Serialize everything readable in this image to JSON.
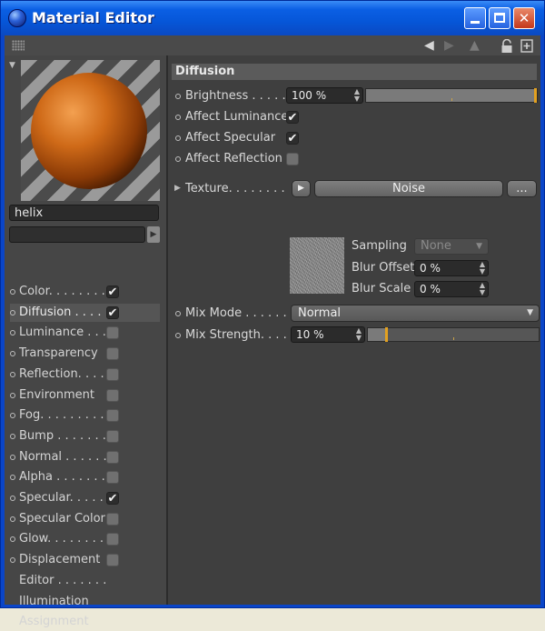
{
  "window": {
    "title": "Material Editor"
  },
  "toolbar": {
    "icons": [
      "grip-icon",
      "arrow-left-icon",
      "arrow-right-icon",
      "pointer-icon",
      "lock-icon",
      "new-window-icon"
    ]
  },
  "material": {
    "name": "helix"
  },
  "channels": [
    {
      "label": "Color. . . . . . . .",
      "checked": true,
      "dot": true
    },
    {
      "label": "Diffusion . . . . .",
      "checked": true,
      "dot": true,
      "selected": true
    },
    {
      "label": "Luminance . . .",
      "checked": false,
      "dot": true
    },
    {
      "label": "Transparency",
      "checked": false,
      "dot": true
    },
    {
      "label": "Reflection. . . .",
      "checked": false,
      "dot": true
    },
    {
      "label": "Environment",
      "checked": false,
      "dot": true
    },
    {
      "label": "Fog. . . . . . . . .",
      "checked": false,
      "dot": true
    },
    {
      "label": "Bump . . . . . . .",
      "checked": false,
      "dot": true
    },
    {
      "label": "Normal . . . . . .",
      "checked": false,
      "dot": true
    },
    {
      "label": "Alpha . . . . . . .",
      "checked": false,
      "dot": true
    },
    {
      "label": "Specular. . . . .",
      "checked": true,
      "dot": true
    },
    {
      "label": "Specular Color",
      "checked": false,
      "dot": true
    },
    {
      "label": "Glow. . . . . . . .",
      "checked": false,
      "dot": true
    },
    {
      "label": "Displacement",
      "checked": false,
      "dot": true
    },
    {
      "label": "Editor . . . . . . .",
      "checked": null,
      "dot": false
    },
    {
      "label": "Illumination",
      "checked": null,
      "dot": false
    },
    {
      "label": "Assignment",
      "checked": null,
      "dot": false
    }
  ],
  "diffusion": {
    "header": "Diffusion",
    "brightness": {
      "label": "Brightness . . . . .",
      "value": "100 %",
      "fraction": 1.0
    },
    "affect_luminance": {
      "label": "Affect Luminance",
      "checked": true
    },
    "affect_specular": {
      "label": "Affect Specular",
      "checked": true
    },
    "affect_reflection": {
      "label": "Affect Reflection",
      "checked": false
    },
    "texture": {
      "label": "Texture. . . . . . . .",
      "button": "Noise",
      "more": "..."
    },
    "sampling": {
      "label": "Sampling",
      "value": "None"
    },
    "blur_offset": {
      "label": "Blur Offset",
      "value": "0 %"
    },
    "blur_scale": {
      "label": "Blur Scale",
      "value": "0 %"
    },
    "mix_mode": {
      "label": "Mix Mode . . . . . .",
      "value": "Normal"
    },
    "mix_strength": {
      "label": "Mix Strength. . . .",
      "value": "10 %",
      "fraction": 0.1
    }
  },
  "colors": {
    "accent": "#e3a120",
    "panel": "#3f3f3f",
    "titlebar": "#0656d8"
  }
}
